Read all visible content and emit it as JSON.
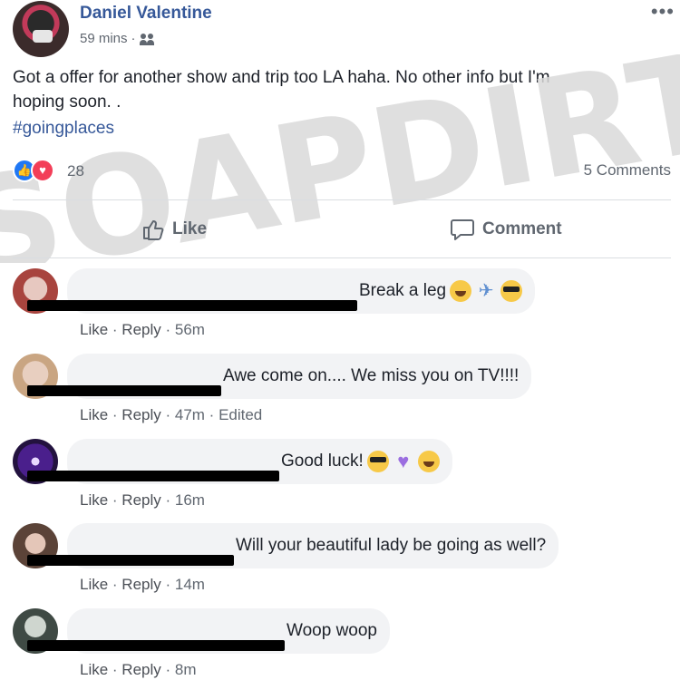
{
  "post": {
    "author": "Daniel Valentine",
    "time": "59 mins",
    "separator": "·",
    "privacy_icon": "friends-icon",
    "more": "•••",
    "text_line1": "Got a offer for another show and trip too LA haha. No other info but I'm",
    "text_line2": "hoping soon. .",
    "hashtag": "#goingplaces"
  },
  "watermark": {
    "text": "SOAPDIRT"
  },
  "stats": {
    "reaction_icons": [
      "like-reaction-icon",
      "love-reaction-icon"
    ],
    "reaction_count": "28",
    "comments": "5 Comments"
  },
  "actions": {
    "like": "Like",
    "comment": "Comment"
  },
  "comments": [
    {
      "text": "Break a leg",
      "emojis": [
        "grin",
        "plane",
        "sunglasses"
      ],
      "like": "Like",
      "reply": "Reply",
      "time": "56m",
      "extra": ""
    },
    {
      "text": "Awe come on.... We miss you on TV!!!!",
      "emojis": [],
      "like": "Like",
      "reply": "Reply",
      "time": "47m",
      "extra": "Edited"
    },
    {
      "text": "Good luck!",
      "emojis": [
        "sunglasses",
        "heart",
        "grin"
      ],
      "like": "Like",
      "reply": "Reply",
      "time": "16m",
      "extra": ""
    },
    {
      "text": "Will your beautiful lady be going as well?",
      "emojis": [],
      "like": "Like",
      "reply": "Reply",
      "time": "14m",
      "extra": ""
    },
    {
      "text": "Woop woop",
      "emojis": [],
      "like": "Like",
      "reply": "Reply",
      "time": "8m",
      "extra": ""
    }
  ],
  "colors": {
    "link": "#365899",
    "meta": "#606770",
    "bubble": "#f2f3f5",
    "like": "#2078f4",
    "love": "#f33e58"
  }
}
